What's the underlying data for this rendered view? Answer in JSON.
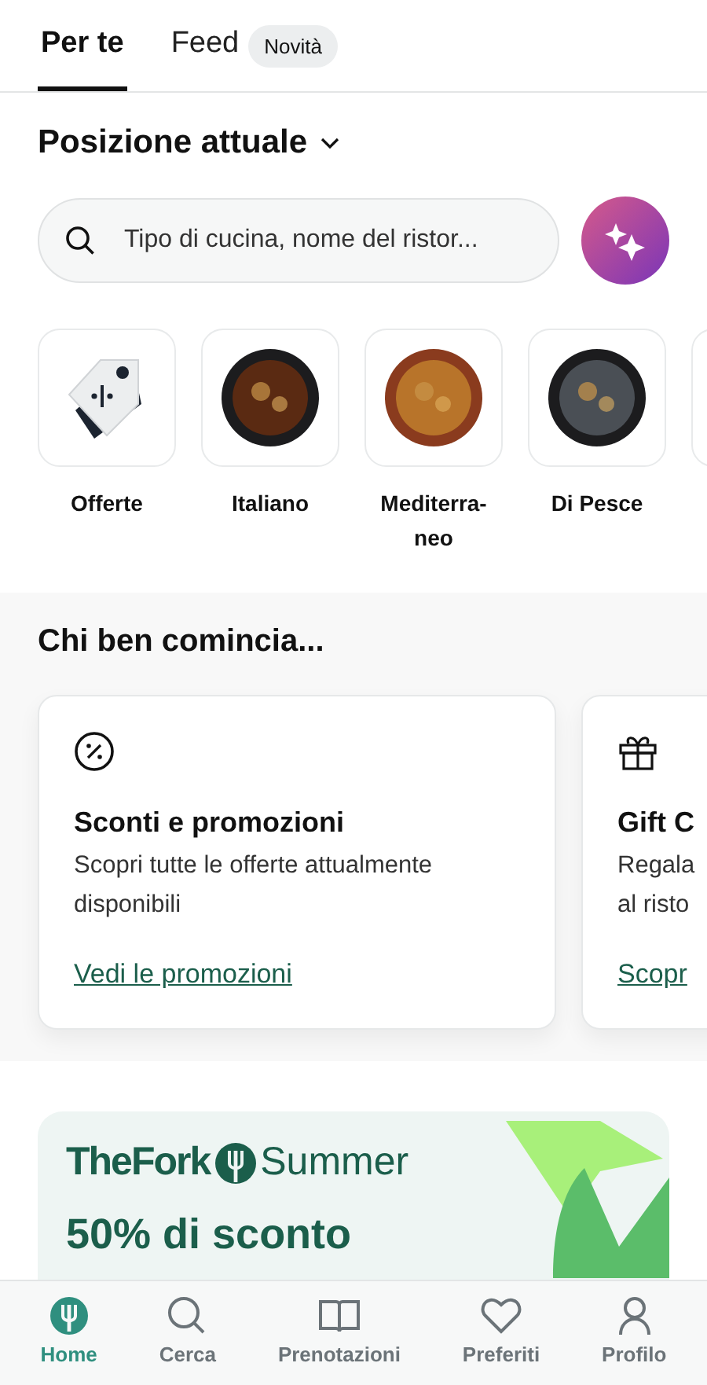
{
  "tabs": [
    {
      "label": "Per te",
      "selected": true
    },
    {
      "label": "Feed",
      "selected": false,
      "badge": "Novità"
    }
  ],
  "location": {
    "title": "Posizione attuale"
  },
  "search": {
    "placeholder": "Tipo di cucina, nome del ristor..."
  },
  "categories": [
    {
      "kind": "offer",
      "label": "Offerte"
    },
    {
      "kind": "dish",
      "label": "Italiano"
    },
    {
      "kind": "dish",
      "label": "Mediterra-neo"
    },
    {
      "kind": "dish",
      "label": "Di Pesce"
    }
  ],
  "section": {
    "title": "Chi ben comincia...",
    "cards": [
      {
        "kind": "percent",
        "title": "Sconti e promozioni",
        "lines": [
          "Scopri tutte le offerte attualmente",
          "disponibili"
        ],
        "link": "Vedi le promozioni"
      },
      {
        "kind": "gift",
        "title": "Gift C",
        "lines": [
          "Regala",
          "al risto"
        ],
        "link": "Scopr"
      }
    ]
  },
  "banner": {
    "brand": "TheFork",
    "edition": "Summer",
    "headline": "50% di sconto"
  },
  "nav": [
    {
      "label": "Home",
      "selected": true
    },
    {
      "label": "Cerca",
      "selected": false
    },
    {
      "label": "Prenotazioni",
      "selected": false
    },
    {
      "label": "Preferiti",
      "selected": false
    },
    {
      "label": "Profilo",
      "selected": false
    }
  ]
}
